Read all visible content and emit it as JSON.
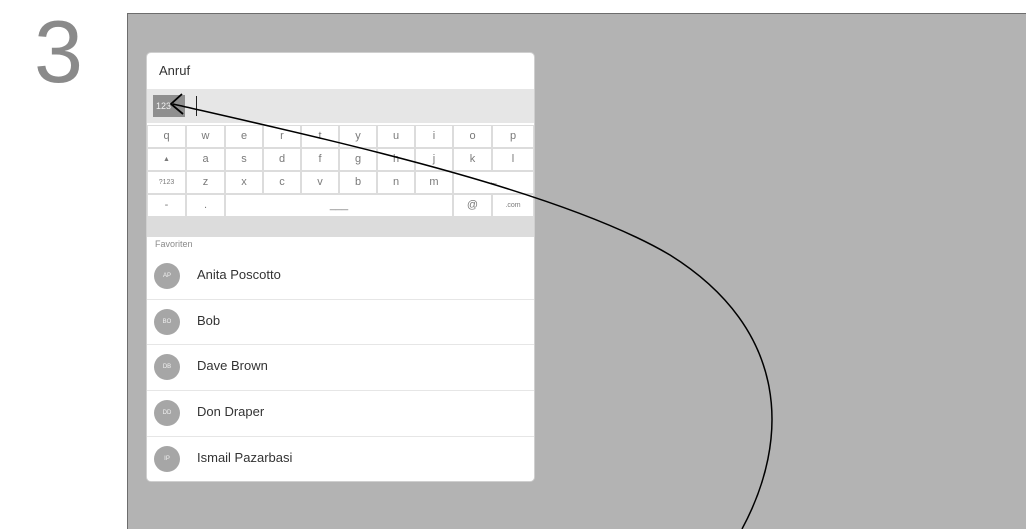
{
  "step_number": "3",
  "dialog": {
    "title": "Anruf",
    "mode_button": "123"
  },
  "keyboard": {
    "rows": [
      [
        "q",
        "w",
        "e",
        "r",
        "t",
        "y",
        "u",
        "i",
        "o",
        "p"
      ],
      [
        "▲",
        "a",
        "s",
        "d",
        "f",
        "g",
        "h",
        "j",
        "k",
        "l"
      ],
      [
        "?123",
        "z",
        "x",
        "c",
        "v",
        "b",
        "n",
        "m",
        "←"
      ],
      [
        "-",
        ".",
        "___",
        "@",
        ".com"
      ]
    ]
  },
  "favorites": {
    "label": "Favoriten",
    "items": [
      {
        "initials": "AP",
        "name": "Anita Poscotto"
      },
      {
        "initials": "BO",
        "name": "Bob"
      },
      {
        "initials": "DB",
        "name": "Dave Brown"
      },
      {
        "initials": "DD",
        "name": "Don Draper"
      },
      {
        "initials": "IP",
        "name": "Ismail Pazarbasi"
      }
    ]
  }
}
